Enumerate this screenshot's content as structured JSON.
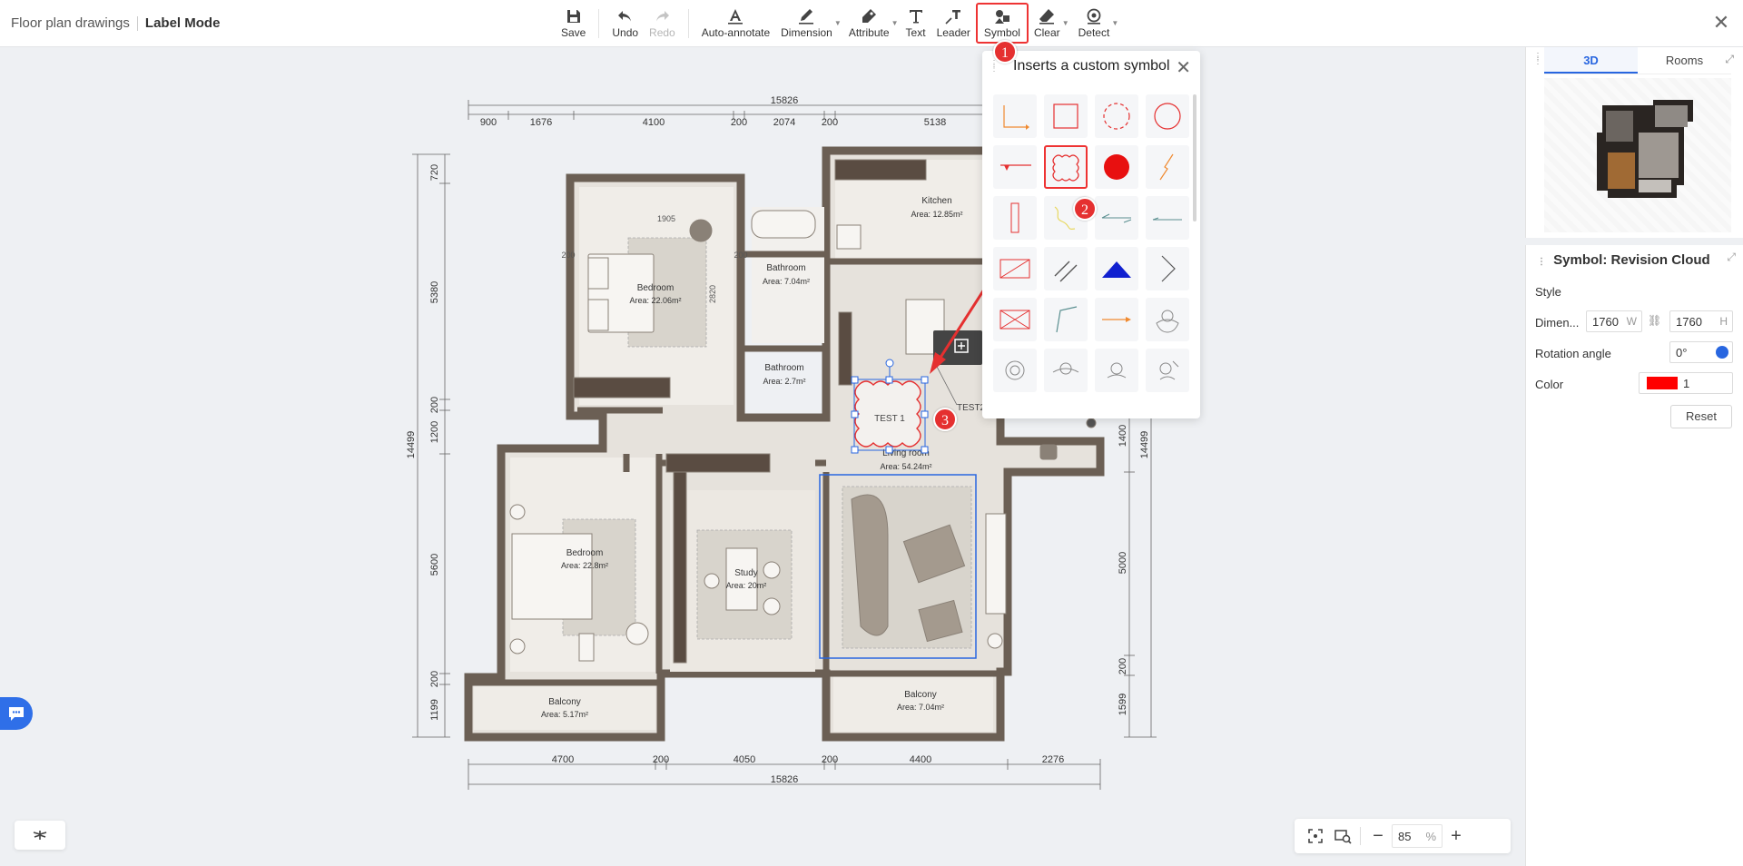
{
  "breadcrumb": {
    "project": "Floor plan drawings",
    "mode": "Label Mode"
  },
  "toolbar": {
    "save": "Save",
    "undo": "Undo",
    "redo": "Redo",
    "auto_annotate": "Auto-annotate",
    "dimension": "Dimension",
    "attribute": "Attribute",
    "text": "Text",
    "leader": "Leader",
    "symbol": "Symbol",
    "clear": "Clear",
    "detect": "Detect"
  },
  "popup": {
    "title": "Inserts a custom symbol"
  },
  "plan": {
    "top_total": "15826",
    "top_dims": [
      "900",
      "1676",
      "4100",
      "200",
      "2074",
      "200",
      "5138"
    ],
    "bottom_dims": [
      "4700",
      "200",
      "4050",
      "200",
      "4400",
      "2276"
    ],
    "bottom_total": "15826",
    "left_dims": [
      "720",
      "5380",
      "200",
      "1200",
      "5600",
      "200",
      "1199"
    ],
    "left_total": "14499",
    "right_dims": [
      "1400",
      "5000",
      "200",
      "1599"
    ],
    "right_total": "14499",
    "inner_dims": [
      "1905",
      "2820",
      "200",
      "200"
    ],
    "rooms": [
      {
        "name": "Bedroom",
        "area": "Area: 22.06m²"
      },
      {
        "name": "Bathroom",
        "area": "Area: 7.04m²"
      },
      {
        "name": "Kitchen",
        "area": "Area: 12.85m²"
      },
      {
        "name": "Bathroom",
        "area": "Area: 2.7m²"
      },
      {
        "name": "Living room",
        "area": "Area: 54.24m²"
      },
      {
        "name": "Bedroom",
        "area": "Area: 22.8m²"
      },
      {
        "name": "Study",
        "area": "Area: 20m²"
      },
      {
        "name": "Balcony",
        "area": "Area: 5.17m²"
      },
      {
        "name": "Balcony",
        "area": "Area: 7.04m²"
      }
    ],
    "labels": {
      "test1": "TEST 1",
      "test2": "TEST2"
    }
  },
  "markers": [
    "1",
    "2",
    "3"
  ],
  "panel3d": {
    "tab_3d": "3D",
    "tab_rooms": "Rooms"
  },
  "properties": {
    "title_prefix": "Symbol:",
    "title_name": "Revision Cloud",
    "style_label": "Style",
    "dimension_label": "Dimen...",
    "width": "1760",
    "width_unit": "W",
    "height": "1760",
    "height_unit": "H",
    "rotation_label": "Rotation angle",
    "rotation": "0°",
    "color_label": "Color",
    "color_value": "1",
    "color_hex": "#ff0000",
    "reset": "Reset"
  },
  "zoom": {
    "value": "85",
    "unit": "%"
  },
  "colors": {
    "accent": "#2866e0",
    "highlight": "#e53030",
    "wall": "#6b5f54"
  }
}
